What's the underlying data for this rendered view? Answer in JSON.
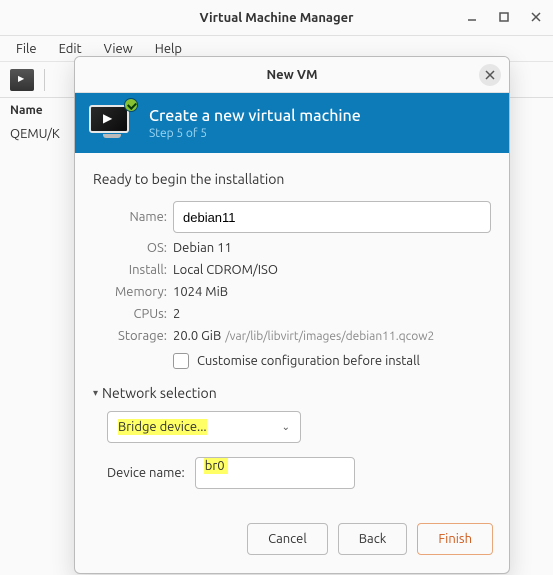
{
  "window": {
    "title": "Virtual Machine Manager",
    "menus": [
      "File",
      "Edit",
      "View",
      "Help"
    ],
    "column_header": "Name",
    "host_row": "QEMU/K"
  },
  "dialog": {
    "title": "New VM",
    "banner": {
      "title": "Create a new virtual machine",
      "subtitle": "Step 5 of 5"
    },
    "ready_text": "Ready to begin the installation",
    "labels": {
      "name": "Name:",
      "os": "OS:",
      "install": "Install:",
      "memory": "Memory:",
      "cpus": "CPUs:",
      "storage": "Storage:"
    },
    "values": {
      "name": "debian11",
      "os": "Debian 11",
      "install": "Local CDROM/ISO",
      "memory": "1024 MiB",
      "cpus": "2",
      "storage_size": "20.0 GiB",
      "storage_path": "/var/lib/libvirt/images/debian11.qcow2"
    },
    "customise_label": "Customise configuration before install",
    "customise_checked": false,
    "network": {
      "expander_label": "Network selection",
      "combo_selected": "Bridge device...",
      "device_name_label": "Device name:",
      "device_name_value": "br0"
    },
    "buttons": {
      "cancel": "Cancel",
      "back": "Back",
      "finish": "Finish"
    }
  }
}
